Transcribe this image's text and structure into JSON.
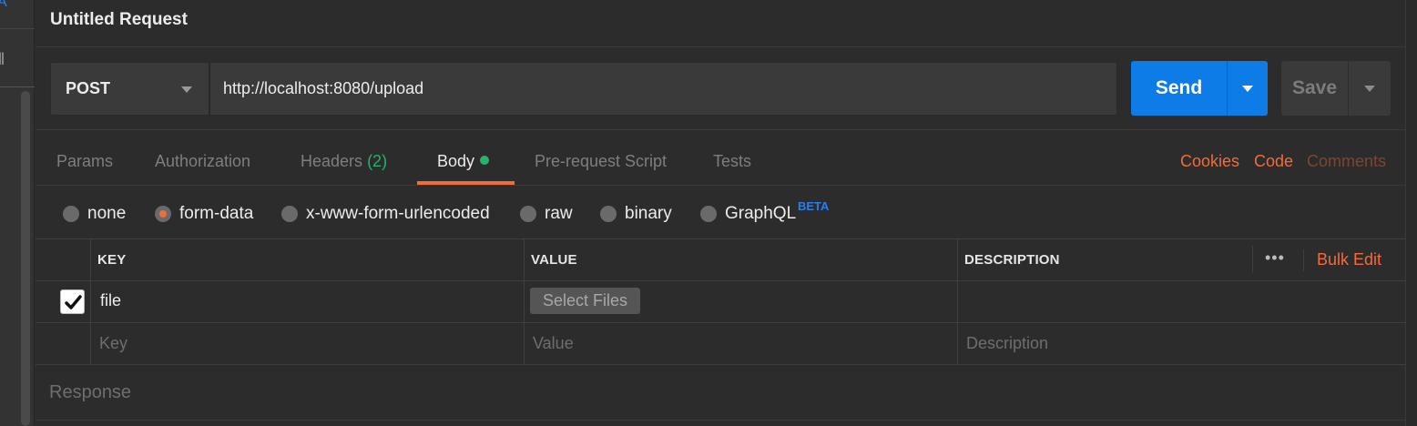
{
  "sidebar": {
    "fragment_top": "A",
    "fragment_mid": "ll"
  },
  "request": {
    "title": "Untitled Request",
    "method": "POST",
    "url": "http://localhost:8080/upload",
    "send_label": "Send",
    "save_label": "Save"
  },
  "tabs": {
    "params": "Params",
    "authorization": "Authorization",
    "headers": "Headers",
    "headers_count": "(2)",
    "body": "Body",
    "prerequest": "Pre-request Script",
    "tests": "Tests",
    "cookies": "Cookies",
    "code": "Code",
    "comments": "Comments"
  },
  "body_types": {
    "none": "none",
    "form_data": "form-data",
    "urlencoded": "x-www-form-urlencoded",
    "raw": "raw",
    "binary": "binary",
    "graphql": "GraphQL",
    "graphql_badge": "BETA",
    "selected": "form-data"
  },
  "table": {
    "headers": {
      "key": "KEY",
      "value": "VALUE",
      "description": "DESCRIPTION"
    },
    "more": "•••",
    "bulk_edit": "Bulk Edit",
    "rows": [
      {
        "checked": true,
        "key": "file",
        "value_button": "Select Files",
        "description": ""
      }
    ],
    "new_row_placeholders": {
      "key": "Key",
      "value": "Value",
      "description": "Description"
    }
  },
  "response": {
    "title": "Response"
  },
  "colors": {
    "accent": "#f26b3a",
    "send": "#0d7ce6",
    "status_dot": "#26b36b",
    "badge": "#2b7de9",
    "background": "#2c2c2c"
  }
}
